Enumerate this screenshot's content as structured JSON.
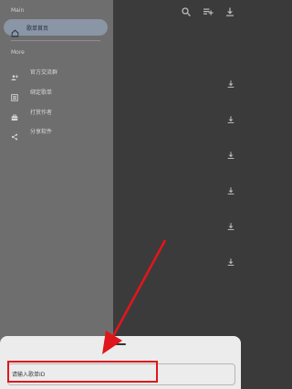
{
  "drawer": {
    "main_label": "Main",
    "more_label": "More",
    "active_item": {
      "label": "歌单首页",
      "icon": "home-icon"
    },
    "items": [
      {
        "label": "官方交流群",
        "icon": "add-person-icon"
      },
      {
        "label": "绑定歌单",
        "icon": "list-box-icon"
      },
      {
        "label": "打赏作者",
        "icon": "briefcase-icon"
      },
      {
        "label": "分享软件",
        "icon": "share-icon"
      }
    ]
  },
  "appbar": {
    "icons": [
      "search-icon",
      "playlist-add-icon",
      "download-icon"
    ]
  },
  "sheet": {
    "input_placeholder": "请输入歌单ID",
    "input_value": ""
  },
  "annotation": {
    "color": "#e0161d"
  }
}
